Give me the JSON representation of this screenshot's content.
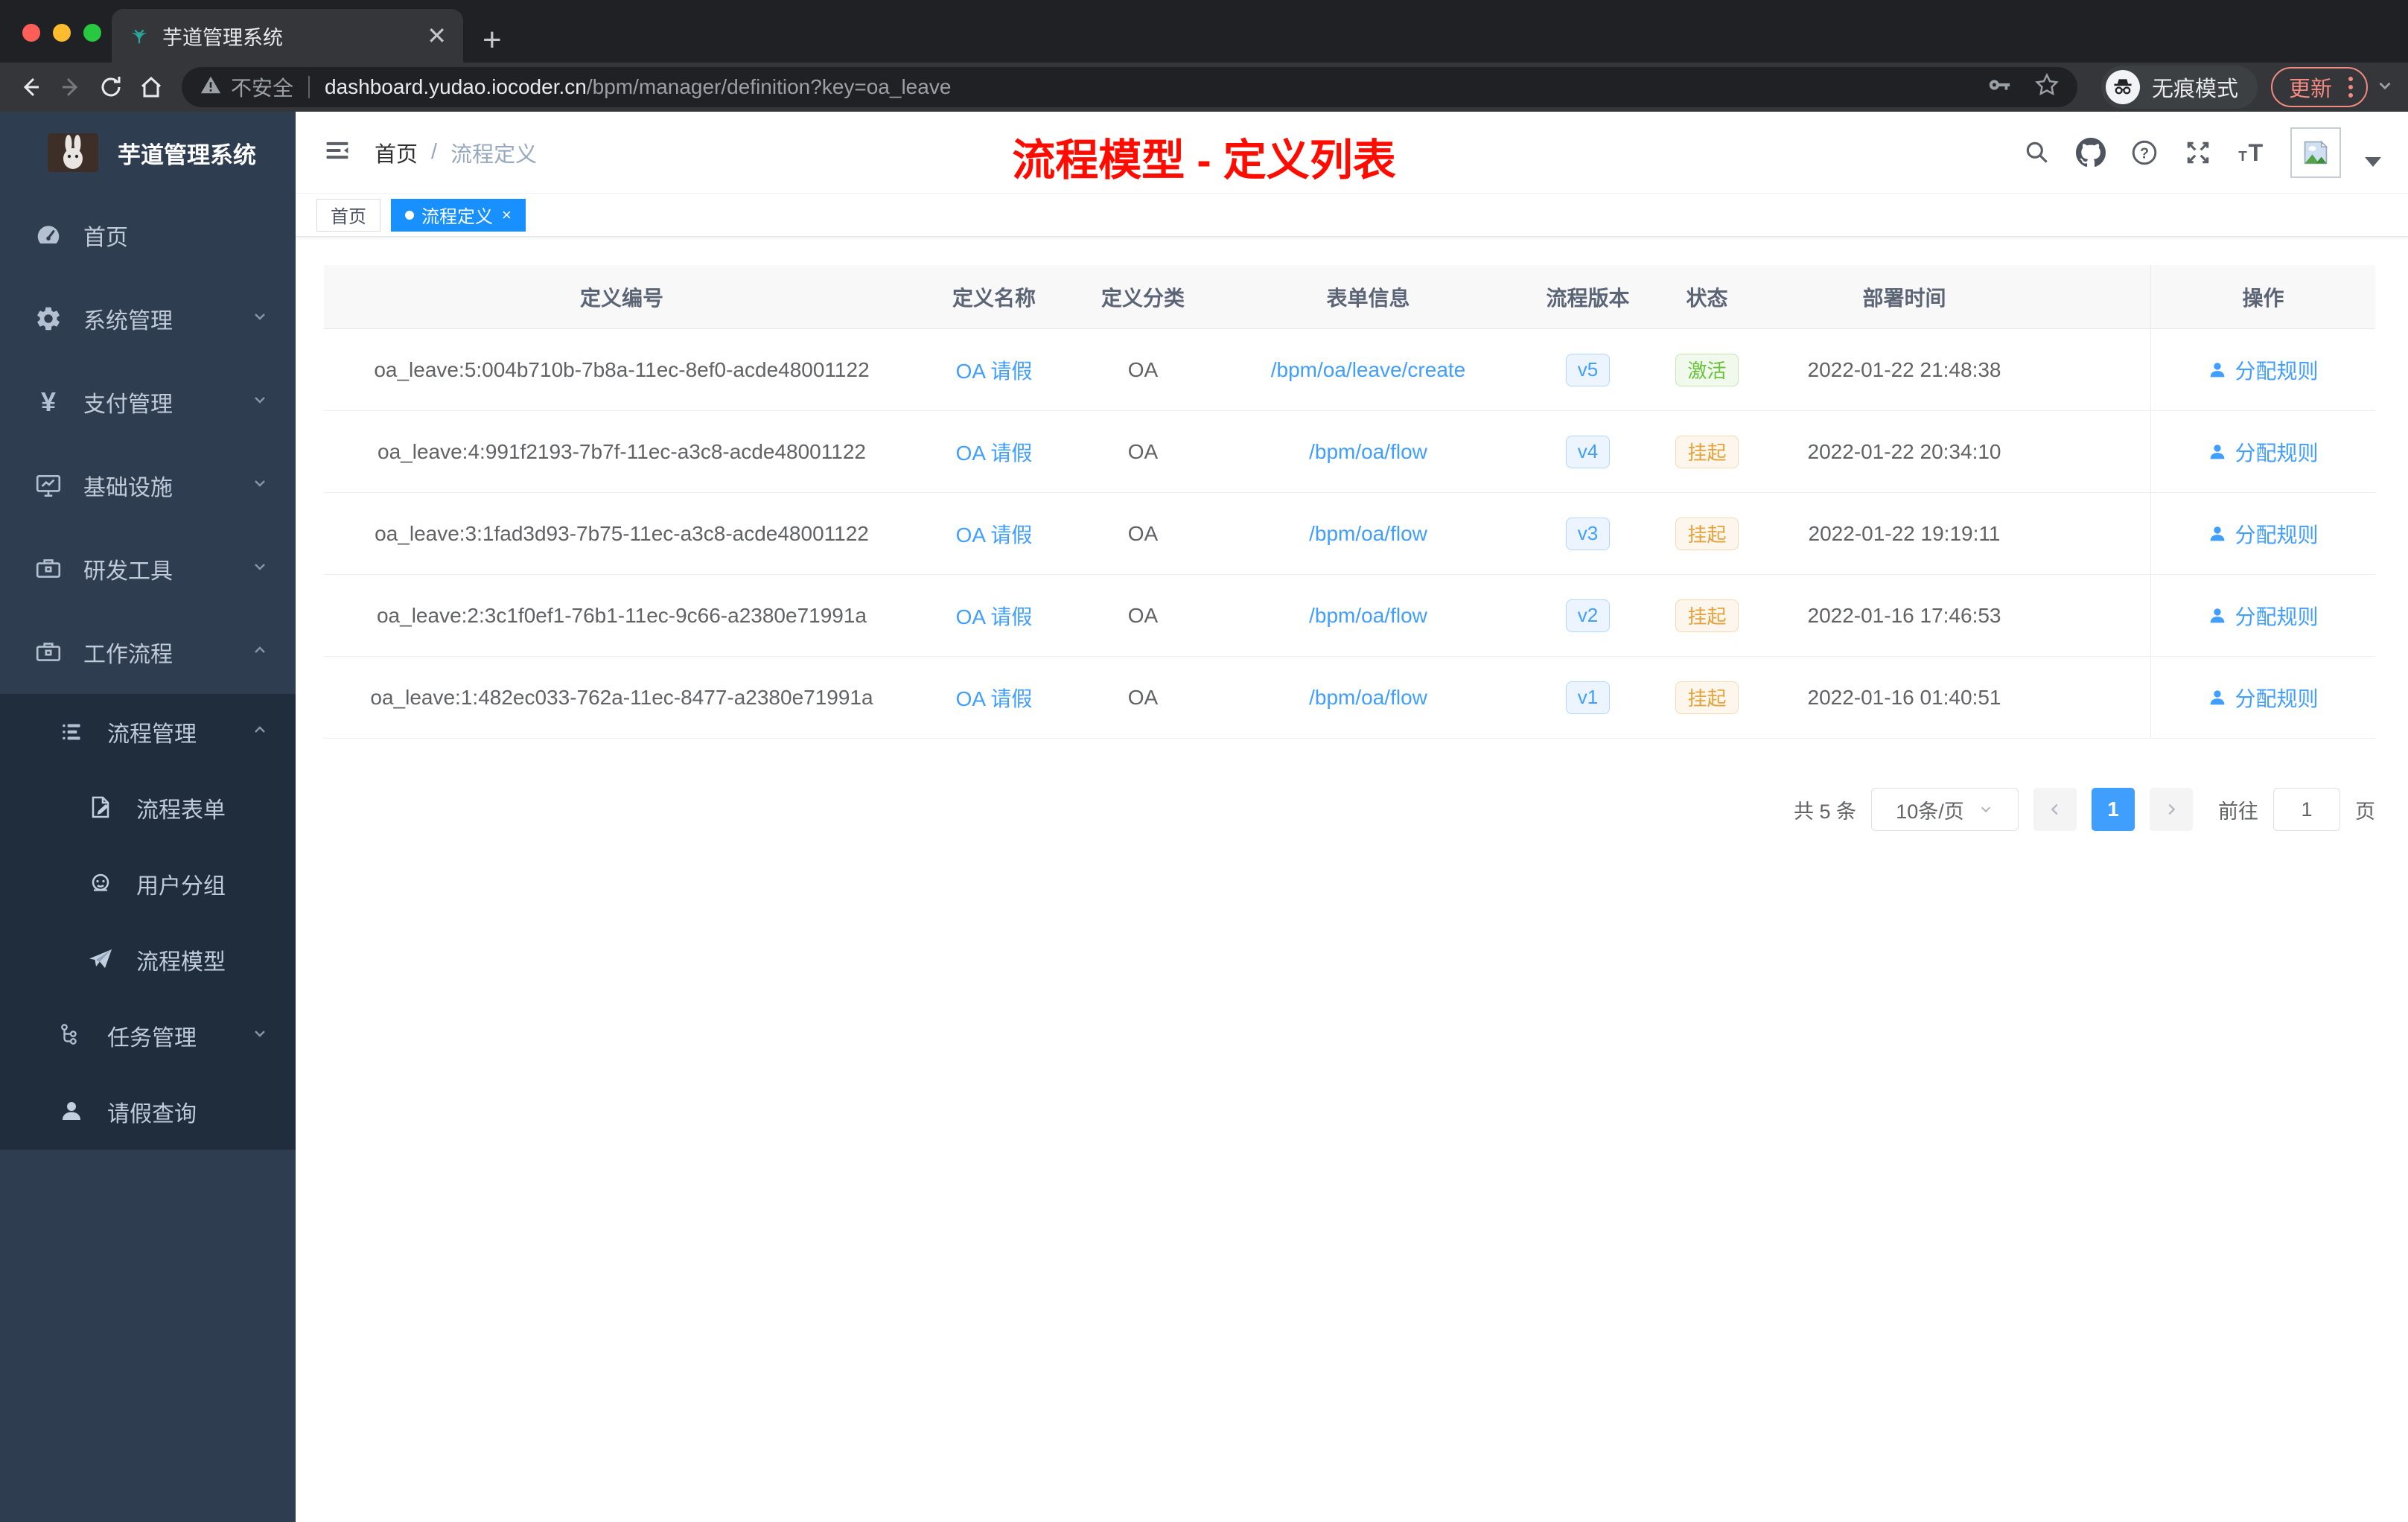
{
  "browser": {
    "tab_title": "芋道管理系统",
    "security_label": "不安全",
    "url_host": "dashboard.yudao.iocoder.cn",
    "url_path": "/bpm/manager/definition?key=oa_leave",
    "incognito_label": "无痕模式",
    "update_label": "更新"
  },
  "sidebar": {
    "app_title": "芋道管理系统",
    "items": [
      {
        "label": "首页"
      },
      {
        "label": "系统管理"
      },
      {
        "label": "支付管理"
      },
      {
        "label": "基础设施"
      },
      {
        "label": "研发工具"
      },
      {
        "label": "工作流程"
      },
      {
        "label": "流程管理"
      },
      {
        "label": "流程表单"
      },
      {
        "label": "用户分组"
      },
      {
        "label": "流程模型"
      },
      {
        "label": "任务管理"
      },
      {
        "label": "请假查询"
      }
    ]
  },
  "header": {
    "breadcrumb_home": "首页",
    "breadcrumb_sep": "/",
    "breadcrumb_current": "流程定义"
  },
  "annotation": {
    "title": "流程模型 - 定义列表"
  },
  "tags": {
    "home": "首页",
    "active": "流程定义"
  },
  "table": {
    "columns": [
      "定义编号",
      "定义名称",
      "定义分类",
      "表单信息",
      "流程版本",
      "状态",
      "部署时间",
      "操作"
    ],
    "rows": [
      {
        "id": "oa_leave:5:004b710b-7b8a-11ec-8ef0-acde48001122",
        "name": "OA 请假",
        "category": "OA",
        "form": "/bpm/oa/leave/create",
        "version": "v5",
        "status": "激活",
        "time": "2022-01-22 21:48:38",
        "action": "分配规则"
      },
      {
        "id": "oa_leave:4:991f2193-7b7f-11ec-a3c8-acde48001122",
        "name": "OA 请假",
        "category": "OA",
        "form": "/bpm/oa/flow",
        "version": "v4",
        "status": "挂起",
        "time": "2022-01-22 20:34:10",
        "action": "分配规则"
      },
      {
        "id": "oa_leave:3:1fad3d93-7b75-11ec-a3c8-acde48001122",
        "name": "OA 请假",
        "category": "OA",
        "form": "/bpm/oa/flow",
        "version": "v3",
        "status": "挂起",
        "time": "2022-01-22 19:19:11",
        "action": "分配规则"
      },
      {
        "id": "oa_leave:2:3c1f0ef1-76b1-11ec-9c66-a2380e71991a",
        "name": "OA 请假",
        "category": "OA",
        "form": "/bpm/oa/flow",
        "version": "v2",
        "status": "挂起",
        "time": "2022-01-16 17:46:53",
        "action": "分配规则"
      },
      {
        "id": "oa_leave:1:482ec033-762a-11ec-8477-a2380e71991a",
        "name": "OA 请假",
        "category": "OA",
        "form": "/bpm/oa/flow",
        "version": "v1",
        "status": "挂起",
        "time": "2022-01-16 01:40:51",
        "action": "分配规则"
      }
    ]
  },
  "pagination": {
    "total_label": "共 5 条",
    "page_size": "10条/页",
    "current_page": "1",
    "goto_label": "前往",
    "goto_value": "1",
    "page_unit": "页"
  },
  "colors": {
    "primary": "#409eff",
    "tag_active": "#1890ff",
    "status_active": "#67c23a",
    "status_suspended": "#e6a23c",
    "annotation_red": "#ff0b00",
    "sidebar_bg": "#2e3d50",
    "submenu_bg": "#1f2d3d"
  }
}
